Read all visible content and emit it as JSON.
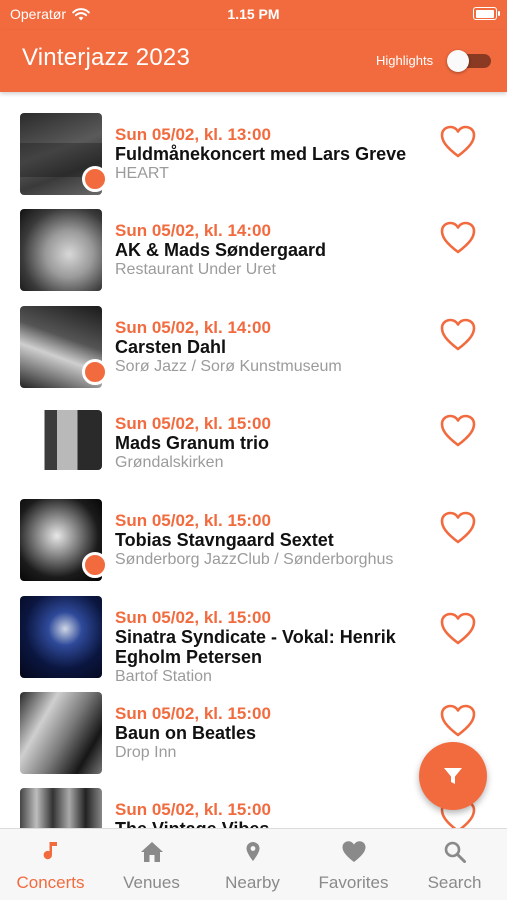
{
  "status_bar": {
    "carrier": "Operatør",
    "time": "1.15 PM"
  },
  "app_bar": {
    "title": "Vinterjazz 2023",
    "highlights_label": "Highlights",
    "highlights_on": false
  },
  "concerts": [
    {
      "time": "Sun 05/02, kl. 13:00",
      "title": "Fuldmånekoncert med Lars Greve",
      "venue": "HEART",
      "badge": true,
      "favorite": false
    },
    {
      "time": "Sun 05/02, kl. 14:00",
      "title": "AK & Mads Søndergaard",
      "venue": "Restaurant Under Uret",
      "badge": false,
      "favorite": false
    },
    {
      "time": "Sun 05/02, kl. 14:00",
      "title": "Carsten Dahl",
      "venue": "Sorø Jazz / Sorø Kunstmuseum",
      "badge": true,
      "favorite": false
    },
    {
      "time": "Sun 05/02, kl. 15:00",
      "title": "Mads Granum trio",
      "venue": "Grøndalskirken",
      "badge": false,
      "favorite": false
    },
    {
      "time": "Sun 05/02, kl. 15:00",
      "title": "Tobias Stavngaard Sextet",
      "venue": "Sønderborg JazzClub / Sønderborghus",
      "badge": true,
      "favorite": false
    },
    {
      "time": "Sun 05/02, kl. 15:00",
      "title": "Sinatra Syndicate - Vokal: Henrik Egholm Petersen",
      "venue": "Bartof Station",
      "badge": false,
      "favorite": false
    },
    {
      "time": "Sun 05/02, kl. 15:00",
      "title": "Baun on Beatles",
      "venue": "Drop Inn",
      "badge": false,
      "favorite": false
    },
    {
      "time": "Sun 05/02, kl. 15:00",
      "title": "The Vintage Vibes",
      "venue": "",
      "badge": false,
      "favorite": false
    }
  ],
  "tabs": [
    {
      "label": "Concerts",
      "icon": "music-note-icon",
      "active": true
    },
    {
      "label": "Venues",
      "icon": "home-icon",
      "active": false
    },
    {
      "label": "Nearby",
      "icon": "location-pin-icon",
      "active": false
    },
    {
      "label": "Favorites",
      "icon": "heart-icon",
      "active": false
    },
    {
      "label": "Search",
      "icon": "search-icon",
      "active": false
    }
  ],
  "colors": {
    "accent": "#f26b3f",
    "venue_text": "#9b9b9b",
    "tab_inactive": "#8a8a8a"
  }
}
